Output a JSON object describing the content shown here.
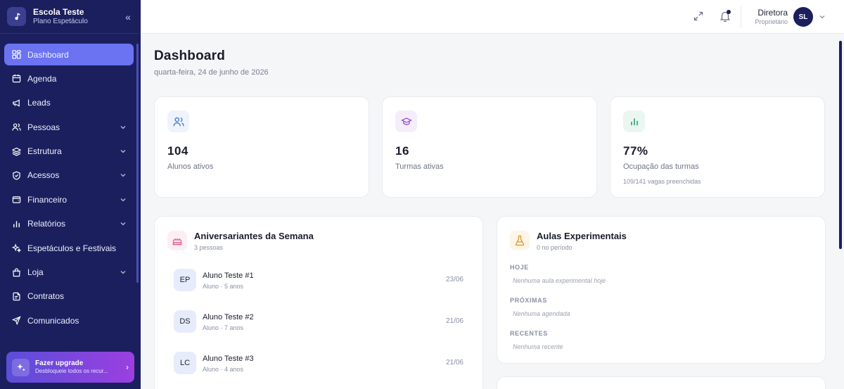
{
  "brand": {
    "name": "Escola Teste",
    "plan": "Plano Espetáculo",
    "collapse_icon": "«"
  },
  "nav": [
    {
      "label": "Dashboard",
      "icon": "dashboard-icon",
      "active": true,
      "expandable": false
    },
    {
      "label": "Agenda",
      "icon": "calendar-icon",
      "expandable": false
    },
    {
      "label": "Leads",
      "icon": "megaphone-icon",
      "expandable": false
    },
    {
      "label": "Pessoas",
      "icon": "users-icon",
      "expandable": true
    },
    {
      "label": "Estrutura",
      "icon": "layers-icon",
      "expandable": true
    },
    {
      "label": "Acessos",
      "icon": "shield-icon",
      "expandable": true
    },
    {
      "label": "Financeiro",
      "icon": "wallet-icon",
      "expandable": true
    },
    {
      "label": "Relatórios",
      "icon": "bar-chart-icon",
      "expandable": true
    },
    {
      "label": "Espetáculos e Festivais",
      "icon": "sparkles-icon",
      "expandable": false
    },
    {
      "label": "Loja",
      "icon": "shop-icon",
      "expandable": true
    },
    {
      "label": "Contratos",
      "icon": "contract-icon",
      "expandable": false
    },
    {
      "label": "Comunicados",
      "icon": "send-icon",
      "expandable": false
    }
  ],
  "upgrade": {
    "title": "Fazer upgrade",
    "subtitle": "Desbloqueie todos os recur...",
    "chevron": "›"
  },
  "topbar": {
    "user_name": "Diretora",
    "user_role": "Proprietário",
    "avatar_initials": "SL",
    "has_notification": true
  },
  "page": {
    "title": "Dashboard",
    "date": "quarta-feira, 24 de junho de 2026"
  },
  "stats": [
    {
      "value": "104",
      "label": "Alunos ativos",
      "sub": "",
      "icon": "users-icon",
      "color": "#4a7bd6",
      "bg": "#eef3fc"
    },
    {
      "value": "16",
      "label": "Turmas ativas",
      "sub": "",
      "icon": "graduation-cap-icon",
      "color": "#8b3fd4",
      "bg": "#f4eefc"
    },
    {
      "value": "77%",
      "label": "Ocupação das turmas",
      "sub": "109/141 vagas preenchidas",
      "icon": "bar-chart-icon",
      "color": "#2fa36b",
      "bg": "#eaf7f0"
    }
  ],
  "birthdays": {
    "title": "Aniversariantes da Semana",
    "count_text": "3 pessoas",
    "icon": "cake-icon",
    "items": [
      {
        "initials": "EP",
        "name": "Aluno Teste #1",
        "meta": "Aluno · 5 anos",
        "date": "23/06"
      },
      {
        "initials": "DS",
        "name": "Aluno Teste #2",
        "meta": "Aluno · 7 anos",
        "date": "21/06"
      },
      {
        "initials": "LC",
        "name": "Aluno Teste #3",
        "meta": "Aluno · 4 anos",
        "date": "21/06"
      }
    ]
  },
  "trials": {
    "title": "Aulas Experimentais",
    "count_text": "0 no período",
    "icon": "flask-icon",
    "sections": [
      {
        "label": "HOJE",
        "empty": "Nenhuma aula experimental hoje"
      },
      {
        "label": "PRÓXIMAS",
        "empty": "Nenhuma agendada"
      },
      {
        "label": "RECENTES",
        "empty": "Nenhuma recente"
      }
    ]
  },
  "colors": {
    "sidebar": "#1b1f5e",
    "active": "#6b73f2",
    "background": "#f5f6f8"
  }
}
